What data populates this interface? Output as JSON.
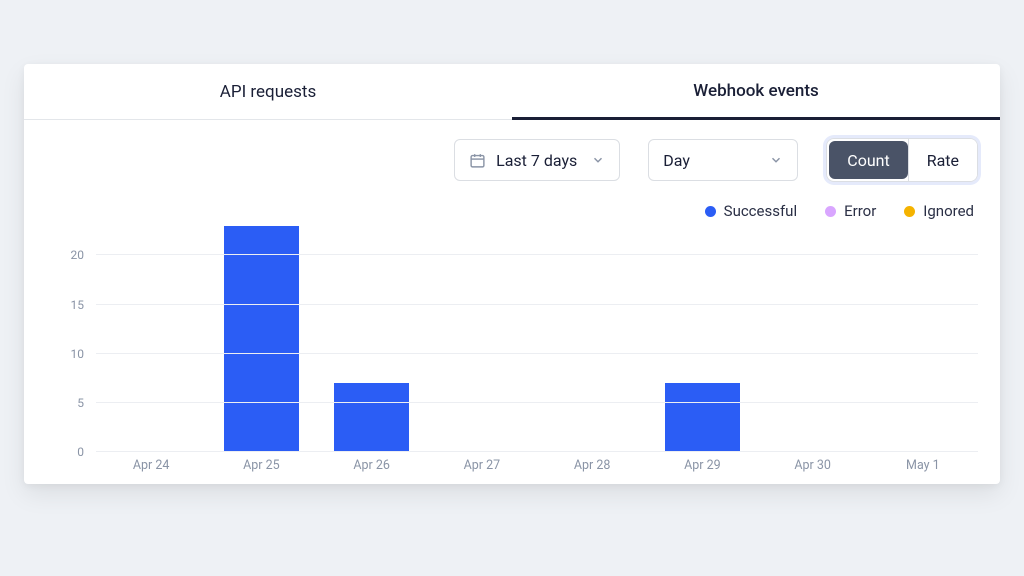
{
  "tabs": [
    {
      "label": "API requests",
      "active": false
    },
    {
      "label": "Webhook events",
      "active": true
    }
  ],
  "controls": {
    "range_label": "Last 7 days",
    "granularity_label": "Day",
    "segmented": {
      "count_label": "Count",
      "rate_label": "Rate",
      "active": "count"
    }
  },
  "legend": [
    {
      "label": "Successful",
      "color": "#2b5df5"
    },
    {
      "label": "Error",
      "color": "#d9a6ff"
    },
    {
      "label": "Ignored",
      "color": "#f5b300"
    }
  ],
  "chart_data": {
    "type": "bar",
    "categories": [
      "Apr 24",
      "Apr 25",
      "Apr 26",
      "Apr 27",
      "Apr 28",
      "Apr 29",
      "Apr 30",
      "May 1"
    ],
    "series": [
      {
        "name": "Successful",
        "values": [
          0,
          23,
          7,
          0,
          0,
          7,
          0,
          0
        ]
      },
      {
        "name": "Error",
        "values": [
          0,
          0,
          0,
          0,
          0,
          0,
          0,
          0
        ]
      },
      {
        "name": "Ignored",
        "values": [
          0,
          0,
          0,
          0,
          0,
          0,
          0,
          0
        ]
      }
    ],
    "y_ticks": [
      0,
      5,
      10,
      15,
      20
    ],
    "ylim": [
      0,
      23
    ],
    "xlabel": "",
    "ylabel": "",
    "title": ""
  }
}
